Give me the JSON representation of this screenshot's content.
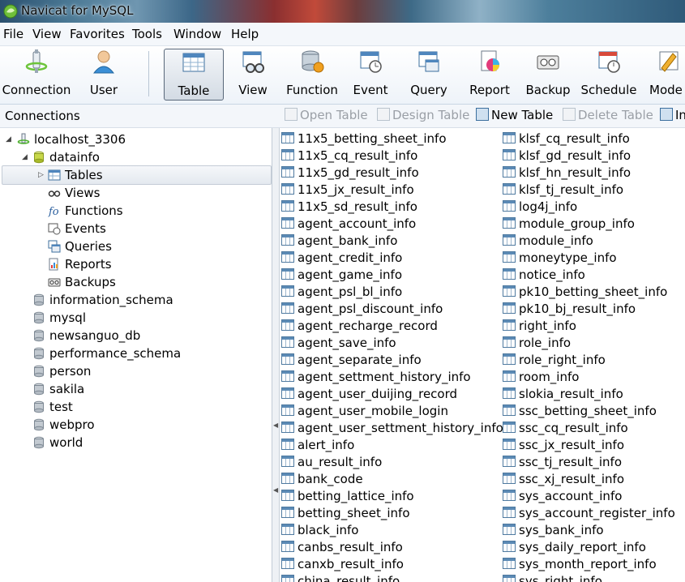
{
  "window": {
    "title": "Navicat for MySQL"
  },
  "menu": [
    "File",
    "View",
    "Favorites",
    "Tools",
    "Window",
    "Help"
  ],
  "toolbar": [
    {
      "label": "Connection",
      "icon": "connection-icon"
    },
    {
      "label": "User",
      "icon": "user-icon"
    },
    {
      "label": "Table",
      "icon": "table-icon",
      "active": true
    },
    {
      "label": "View",
      "icon": "view-icon"
    },
    {
      "label": "Function",
      "icon": "function-icon"
    },
    {
      "label": "Event",
      "icon": "event-icon"
    },
    {
      "label": "Query",
      "icon": "query-icon"
    },
    {
      "label": "Report",
      "icon": "report-icon"
    },
    {
      "label": "Backup",
      "icon": "backup-icon"
    },
    {
      "label": "Schedule",
      "icon": "schedule-icon"
    },
    {
      "label": "Mode",
      "icon": "model-icon"
    }
  ],
  "connections_title": "Connections",
  "object_toolbar": {
    "open_table": "Open Table",
    "design_table": "Design Table",
    "new_table": "New Table",
    "delete_table": "Delete Table",
    "import": "In"
  },
  "tree": {
    "connection": "localhost_3306",
    "active_db": "datainfo",
    "db_children": [
      "Tables",
      "Views",
      "Functions",
      "Events",
      "Queries",
      "Reports",
      "Backups"
    ],
    "other_dbs": [
      "information_schema",
      "mysql",
      "newsanguo_db",
      "performance_schema",
      "person",
      "sakila",
      "test",
      "webpro",
      "world"
    ]
  },
  "tables_col1": [
    "11x5_betting_sheet_info",
    "11x5_cq_result_info",
    "11x5_gd_result_info",
    "11x5_jx_result_info",
    "11x5_sd_result_info",
    "agent_account_info",
    "agent_bank_info",
    "agent_credit_info",
    "agent_game_info",
    "agent_psl_bl_info",
    "agent_psl_discount_info",
    "agent_recharge_record",
    "agent_save_info",
    "agent_separate_info",
    "agent_settment_history_info",
    "agent_user_duijing_record",
    "agent_user_mobile_login",
    "agent_user_settment_history_info",
    "alert_info",
    "au_result_info",
    "bank_code",
    "betting_lattice_info",
    "betting_sheet_info",
    "black_info",
    "canbs_result_info",
    "canxb_result_info",
    "china_result_info"
  ],
  "tables_col2": [
    "klsf_cq_result_info",
    "klsf_gd_result_info",
    "klsf_hn_result_info",
    "klsf_tj_result_info",
    "log4j_info",
    "module_group_info",
    "module_info",
    "moneytype_info",
    "notice_info",
    "pk10_betting_sheet_info",
    "pk10_bj_result_info",
    "right_info",
    "role_info",
    "role_right_info",
    "room_info",
    "slokia_result_info",
    "ssc_betting_sheet_info",
    "ssc_cq_result_info",
    "ssc_jx_result_info",
    "ssc_tj_result_info",
    "ssc_xj_result_info",
    "sys_account_info",
    "sys_account_register_info",
    "sys_bank_info",
    "sys_daily_report_info",
    "sys_month_report_info",
    "sys_right_info"
  ]
}
